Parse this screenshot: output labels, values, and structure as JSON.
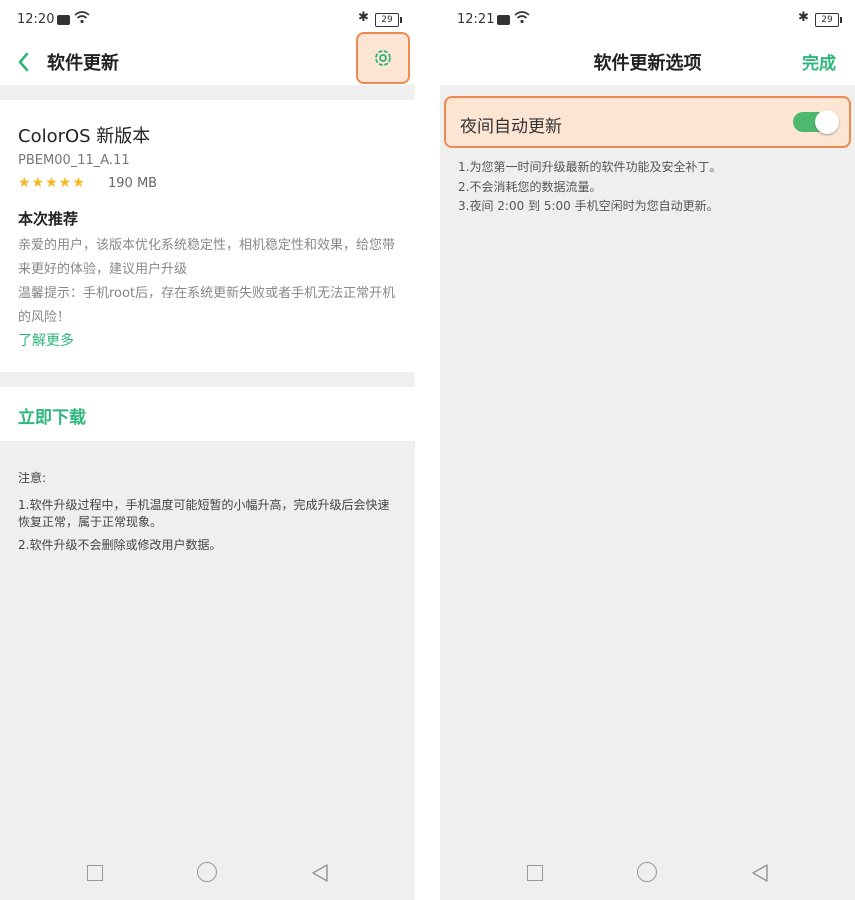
{
  "left": {
    "status": {
      "time": "12:20",
      "battery": "29"
    },
    "header": {
      "title": "软件更新"
    },
    "card": {
      "app_name": "ColorOS 新版本",
      "version": "PBEM00_11_A.11",
      "stars": "★★★★★",
      "size": "190 MB",
      "section_title": "本次推荐",
      "description": [
        "亲爱的用户，该版本优化系统稳定性，相机稳定性和效果，给您带来更好的体验，建议用户升级",
        "温馨提示：手机root后，存在系统更新失败或者手机无法正常开机的风险！"
      ],
      "learn_more": "了解更多"
    },
    "download_label": "立即下载",
    "notes": {
      "title": "注意:",
      "items": [
        "1.软件升级过程中，手机温度可能短暂的小幅升高，完成升级后会快速恢复正常，属于正常现象。",
        "2.软件升级不会删除或修改用户数据。"
      ]
    }
  },
  "right": {
    "status": {
      "time": "12:21",
      "battery": "29"
    },
    "header": {
      "title": "软件更新选项",
      "done_label": "完成"
    },
    "toggle": {
      "label": "夜间自动更新",
      "enabled": true
    },
    "description": [
      "1.为您第一时间升级最新的软件功能及安全补丁。",
      "2.不会消耗您的数据流量。",
      "3.夜间 2:00 到 5:00 手机空闲时为您自动更新。"
    ]
  },
  "colors": {
    "accent": "#2db77b",
    "highlight_border": "#f0884f",
    "highlight_fill": "#fde5d4",
    "switch_on": "#4fb86f"
  },
  "icons": {
    "back": "chevron-left-icon",
    "settings": "gear-icon",
    "nav_recent": "square-icon",
    "nav_home": "circle-icon",
    "nav_back": "triangle-left-icon"
  }
}
